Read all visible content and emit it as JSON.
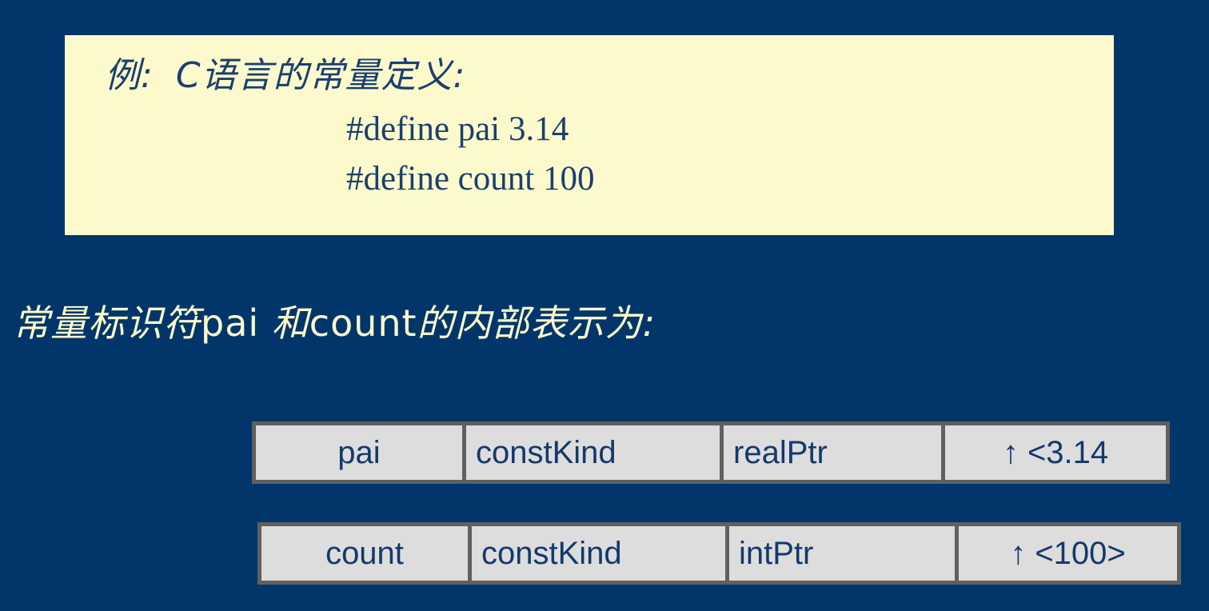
{
  "slide": {
    "background_color": "#02366b",
    "example_box": {
      "background_color": "#fcfacc",
      "text_color": "#1b3f6e",
      "label": "例:",
      "title": "C语言的常量定义:",
      "code_lines": [
        "#define pai 3.14",
        "#define count 100"
      ]
    },
    "heading": {
      "text_color": "#fcfacc",
      "prefix_cjk": "常量标识符",
      "identifier_1": "pai",
      "middle_cjk": "和",
      "identifier_2": "count",
      "suffix_cjk": "的内部表示为:",
      "full_text": "常量标识符pai 和count的内部表示为:"
    },
    "tables": {
      "border_color": "#606060",
      "cell_background": "#dddddd",
      "cell_text_color": "#14396b",
      "rows": [
        {
          "name": "pai",
          "kind": "constKind",
          "pointer": "realPtr",
          "value": "↑ <3.14"
        },
        {
          "name": "count",
          "kind": "constKind",
          "pointer": "intPtr",
          "value": "↑ <100>"
        }
      ]
    }
  }
}
